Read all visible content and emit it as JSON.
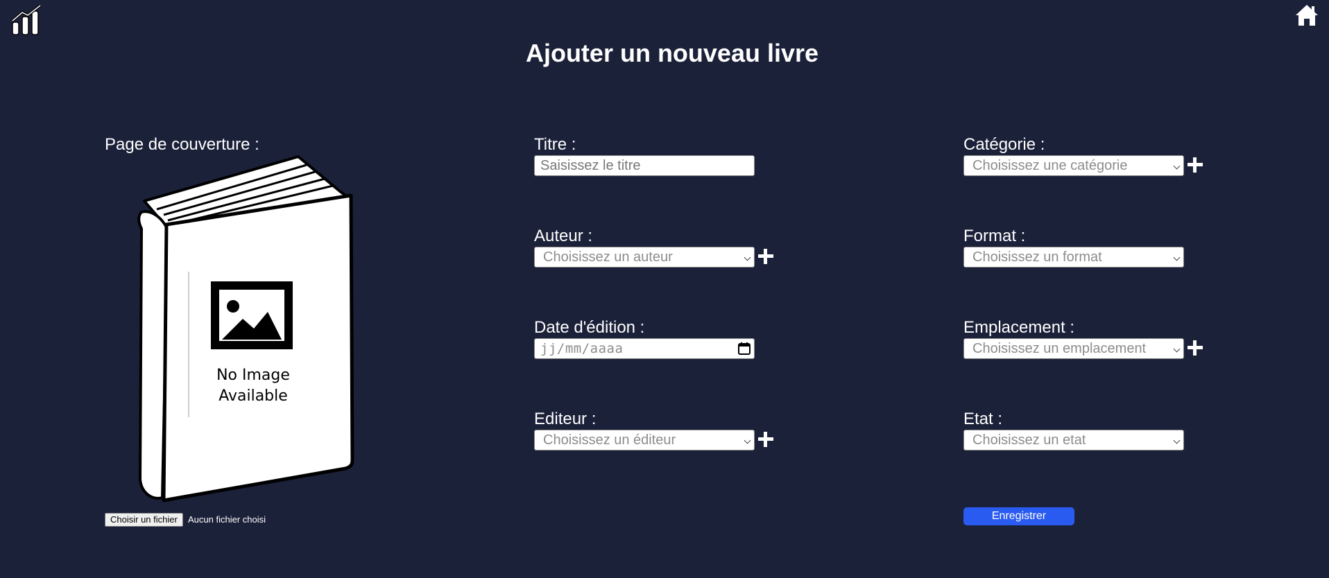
{
  "page": {
    "title": "Ajouter un nouveau livre"
  },
  "header": {
    "logo_icon": "bar-chart-logo",
    "home_icon": "home-icon"
  },
  "cover": {
    "label": "Page de couverture :",
    "placeholder_line1": "No Image",
    "placeholder_line2": "Available",
    "file_button": "Choisir un fichier",
    "file_status": "Aucun fichier choisi"
  },
  "form": {
    "titre": {
      "label": "Titre :",
      "placeholder": "Saisissez le titre"
    },
    "auteur": {
      "label": "Auteur :",
      "placeholder": "Choisissez un auteur"
    },
    "date_edition": {
      "label": "Date d'édition :",
      "placeholder": "jj/mm/aaaa"
    },
    "editeur": {
      "label": "Editeur :",
      "placeholder": "Choisissez un éditeur"
    },
    "categorie": {
      "label": "Catégorie :",
      "placeholder": "Choisissez une catégorie"
    },
    "format": {
      "label": "Format :",
      "placeholder": "Choisissez un format"
    },
    "emplacement": {
      "label": "Emplacement :",
      "placeholder": "Choisissez un emplacement"
    },
    "etat": {
      "label": "Etat :",
      "placeholder": "Choisissez un etat"
    },
    "save_label": "Enregistrer"
  },
  "colors": {
    "background": "#1c213a",
    "accent_button": "#2a5bf0",
    "text": "#ffffff"
  }
}
